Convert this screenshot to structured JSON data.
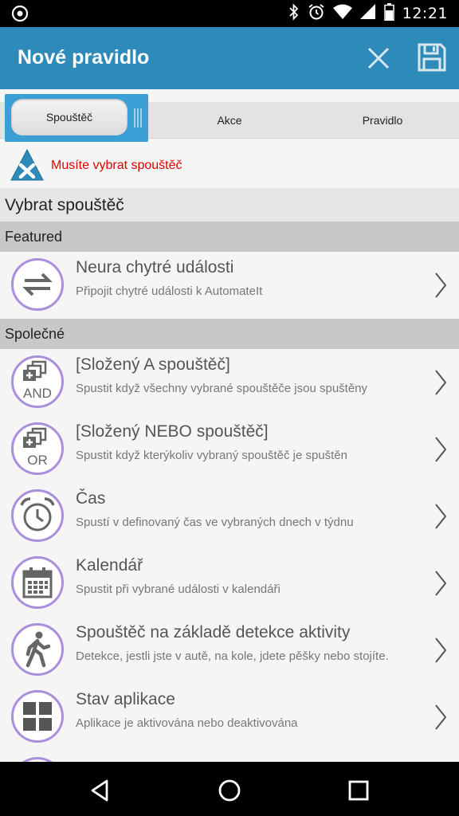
{
  "status_bar": {
    "time": "12:21"
  },
  "app_bar": {
    "title": "Nové pravidlo",
    "close_icon": "close-icon",
    "save_icon": "save-icon"
  },
  "tabs": [
    {
      "label": "Spouštěč",
      "active": true
    },
    {
      "label": "Akce",
      "active": false
    },
    {
      "label": "Pravidlo",
      "active": false
    }
  ],
  "warning": {
    "text": "Musíte vybrat spouštěč",
    "color": "#e00000"
  },
  "section_title": "Vybrat spouštěč",
  "groups": {
    "featured": "Featured",
    "common": "Společné"
  },
  "items": [
    {
      "title": "Neura chytré události",
      "subtitle": "Připojit chytré události k AutomateIt",
      "icon": "arrows-swap-icon"
    },
    {
      "title": "[Složený A spouštěč]",
      "subtitle": "Spustit když všechny vybrané spouštěče jsou spuštěny",
      "icon": "and-icon",
      "icon_text": "AND"
    },
    {
      "title": "[Složený NEBO spouštěč]",
      "subtitle": "Spustit když kterýkoliv vybraný spouštěč je spuštěn",
      "icon": "or-icon",
      "icon_text": "OR"
    },
    {
      "title": "Čas",
      "subtitle": "Spustí v definovaný čas ve vybraných dnech v týdnu",
      "icon": "alarm-clock-icon"
    },
    {
      "title": "Kalendář",
      "subtitle": "Spustit při vybrané události v kalendáři",
      "icon": "calendar-icon"
    },
    {
      "title": "Spouštěč na základě detekce aktivity",
      "subtitle": "Detekce, jestli jste v autě, na kole, jdete pěšky nebo stojíte.",
      "icon": "walking-person-icon"
    },
    {
      "title": "Stav aplikace",
      "subtitle": "Aplikace je aktivována nebo deaktivována",
      "icon": "app-grid-icon"
    }
  ],
  "colors": {
    "app_bar": "#2e8ab8",
    "tab_highlight": "#3a9fd4",
    "icon_ring": "#a98fdc"
  }
}
